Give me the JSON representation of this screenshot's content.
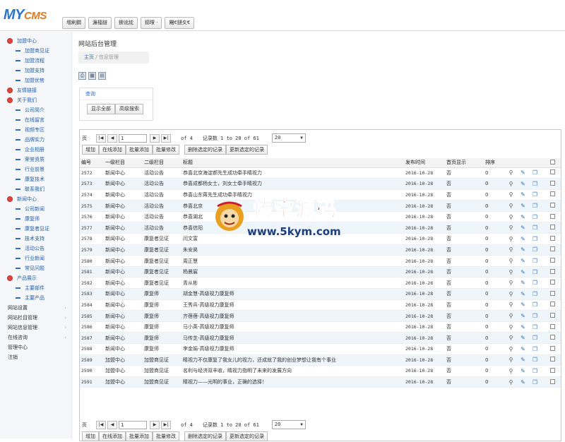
{
  "app": {
    "logo_main": "MY",
    "logo_sub": "CMS"
  },
  "topnav": [
    "増刷鐗",
    "濂楅鐩",
    "鐭讹紞",
    "鍗曢 ·",
    "闀€鏈夊€"
  ],
  "sidebar": {
    "groups": [
      {
        "label": "加盟中心",
        "items": [
          "加盟商见证",
          "加盟流程",
          "加盟支持",
          "加盟优势"
        ]
      },
      {
        "label": "友情链接",
        "items": []
      },
      {
        "label": "关于我们",
        "items": [
          "公司简介",
          "在线留言",
          "视频专区",
          "品牌实力",
          "企业相册",
          "荣誉资质",
          "行业前景",
          "康复技术",
          "联系我们"
        ]
      },
      {
        "label": "新闻中心",
        "items": [
          "公司新闻",
          "康复师",
          "康复者见证",
          "技术支持",
          "活动公告",
          "行业新闻",
          "常见问题"
        ]
      },
      {
        "label": "产品展示",
        "items": [
          "主要部件",
          "主要产品"
        ]
      }
    ],
    "plain": [
      "网站设置",
      "网站栏目管理",
      "网站信息管理",
      "在线咨询",
      "管理中心",
      "注销"
    ]
  },
  "main": {
    "title": "网站后台管理",
    "breadcrumb": {
      "home": "主页",
      "sep": "/",
      "current": "信息管理"
    },
    "query": {
      "title": "查询",
      "show_all": "显示全部",
      "advanced": "高级搜索"
    }
  },
  "grid": {
    "pager": {
      "label": "页",
      "page": "1",
      "of": "of 4",
      "records": "记录数 1 to 20 of 61",
      "page_size": "20",
      "first": "|◀",
      "prev": "◀",
      "next": "▶",
      "last": "▶|"
    },
    "actions": {
      "add": "增加",
      "add_inline": "在线添加",
      "batch_add": "批量添加",
      "batch_edit": "批量修改",
      "delete_sel": "删除选定的记录",
      "update_sel": "更新选定的记录"
    },
    "columns": [
      "编号",
      "一级栏目",
      "二级栏目",
      "标题",
      "发布时间",
      "首页显示",
      "排序"
    ],
    "rows": [
      [
        "2572",
        "新闻中心",
        "活动公告",
        "恭喜北京海淀郝先生成功牵手睛视力",
        "2016-10-28",
        "否",
        "0"
      ],
      [
        "2573",
        "新闻中心",
        "活动公告",
        "恭喜成都杨女士，刘女士牵手睛视力",
        "2016-10-28",
        "否",
        "0"
      ],
      [
        "2574",
        "新闻中心",
        "活动公告",
        "恭喜山东蒋先生成功牵手睛视力",
        "2016-10-28",
        "否",
        "0"
      ],
      [
        "2575",
        "新闻中心",
        "活动公告",
        "恭喜北京",
        "2016-10-28",
        "否",
        "0"
      ],
      [
        "2576",
        "新闻中心",
        "活动公告",
        "恭喜湖北",
        "2016-10-28",
        "否",
        "0"
      ],
      [
        "2577",
        "新闻中心",
        "活动公告",
        "恭喜信阳",
        "2016-10-28",
        "否",
        "0"
      ],
      [
        "2578",
        "新闻中心",
        "康复者见证",
        "闫文富",
        "2016-10-28",
        "否",
        "0"
      ],
      [
        "2579",
        "新闻中心",
        "康复者见证",
        "朱安昊",
        "2016-10-28",
        "否",
        "0"
      ],
      [
        "2580",
        "新闻中心",
        "康复者见证",
        "周正慧",
        "2016-10-28",
        "否",
        "0"
      ],
      [
        "2581",
        "新闻中心",
        "康复者见证",
        "杨晨宸",
        "2016-10-28",
        "否",
        "0"
      ],
      [
        "2582",
        "新闻中心",
        "康复者见证",
        "青从彬",
        "2016-10-28",
        "否",
        "0"
      ],
      [
        "2583",
        "新闻中心",
        "康复师",
        "胡金慧-高级视力康复师",
        "2016-10-28",
        "否",
        "0"
      ],
      [
        "2584",
        "新闻中心",
        "康复师",
        "王秀兵-高级视力康复师",
        "2016-10-28",
        "否",
        "0"
      ],
      [
        "2585",
        "新闻中心",
        "康复师",
        "齐蓓蓓-高级视力康复师",
        "2016-10-28",
        "否",
        "0"
      ],
      [
        "2586",
        "新闻中心",
        "康复师",
        "马小英-高级视力康复师",
        "2016-10-28",
        "否",
        "0"
      ],
      [
        "2587",
        "新闻中心",
        "康复师",
        "马传芝-高级视力康复师",
        "2016-10-28",
        "否",
        "0"
      ],
      [
        "2588",
        "新闻中心",
        "康复师",
        "李金娟-高级视力康复师",
        "2016-10-28",
        "否",
        "0"
      ],
      [
        "2589",
        "加盟中心",
        "加盟商见证",
        "睛视力不仅康复了我女儿的视力，还成就了我的创业梦想让我有个事业",
        "2016-10-28",
        "否",
        "0"
      ],
      [
        "2590",
        "加盟中心",
        "加盟商见证",
        "名利与经济双丰收，睛视力指明了未来的发展方向",
        "2016-10-28",
        "否",
        "0"
      ],
      [
        "2591",
        "加盟中心",
        "加盟商见证",
        "睛视力——光明的事业，正确的选择！",
        "2016-10-28",
        "否",
        "0"
      ]
    ]
  },
  "watermark": {
    "text": "悟空源码",
    "url": "www.5kym.com"
  }
}
